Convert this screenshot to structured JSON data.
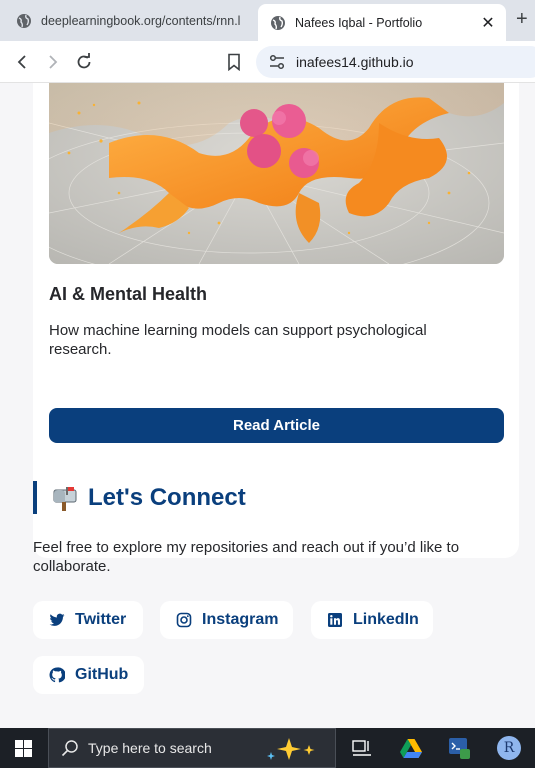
{
  "browser": {
    "tabs": [
      {
        "title": "deeplearningbook.org/contents/rnn.l",
        "active": false
      },
      {
        "title": "Nafees Iqbal - Portfolio",
        "active": true
      }
    ],
    "close_icon": "close-icon",
    "new_tab_icon": "plus-icon",
    "address": "inafees14.github.io"
  },
  "article_card": {
    "title": "AI & Mental Health",
    "description": "How machine learning models can support psychological research.",
    "button_label": "Read Article"
  },
  "connect": {
    "heading": "Let's Connect",
    "description": "Feel free to explore my repositories and reach out if you’d like to collaborate.",
    "links": [
      {
        "label": "Twitter",
        "icon": "twitter-icon"
      },
      {
        "label": "Instagram",
        "icon": "instagram-icon"
      },
      {
        "label": "LinkedIn",
        "icon": "linkedin-icon"
      },
      {
        "label": "GitHub",
        "icon": "github-icon"
      }
    ]
  },
  "taskbar": {
    "search_placeholder": "Type here to search",
    "profile_initial": "R"
  },
  "colors": {
    "accent": "#0a3f7d",
    "page_background": "#f6f6f8",
    "taskbar": "#1c2026"
  }
}
